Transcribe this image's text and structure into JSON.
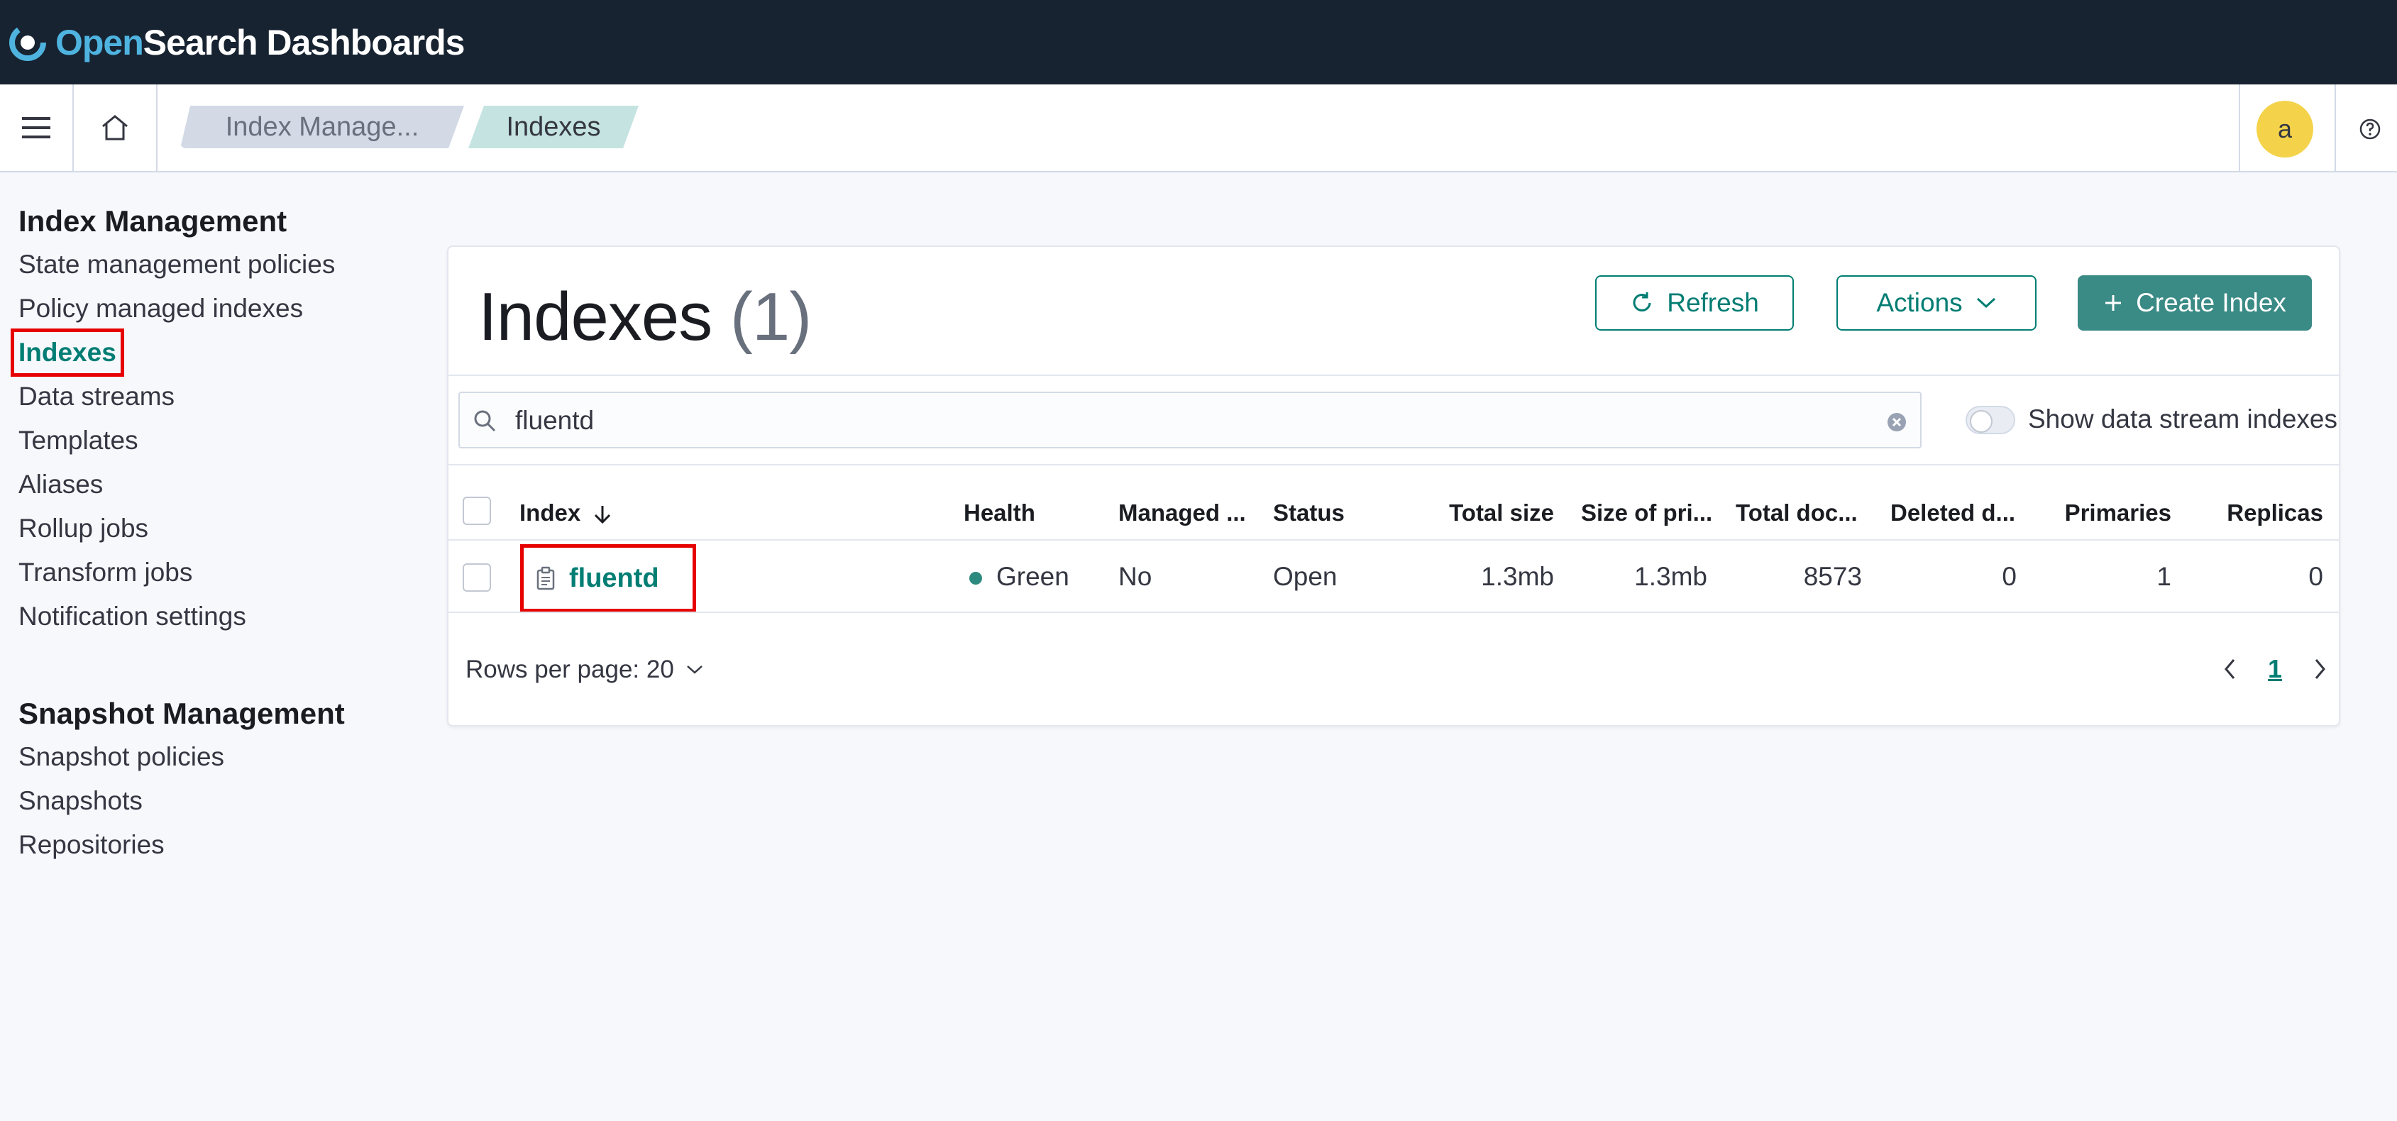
{
  "header": {
    "brand_open": "Open",
    "brand_rest": "Search Dashboards"
  },
  "breadcrumbs": [
    "Index Manage...",
    "Indexes"
  ],
  "user": {
    "avatar_initial": "a"
  },
  "sidebar": {
    "index_management": {
      "title": "Index Management",
      "items": [
        "State management policies",
        "Policy managed indexes",
        "Indexes",
        "Data streams",
        "Templates",
        "Aliases",
        "Rollup jobs",
        "Transform jobs",
        "Notification settings"
      ]
    },
    "snapshot_management": {
      "title": "Snapshot Management",
      "items": [
        "Snapshot policies",
        "Snapshots",
        "Repositories"
      ]
    }
  },
  "main": {
    "title": "Indexes",
    "count": "(1)",
    "buttons": {
      "refresh": "Refresh",
      "actions": "Actions",
      "create": "Create Index"
    },
    "search": {
      "value": "fluentd"
    },
    "toggle_label": "Show data stream indexes",
    "columns": [
      "Index",
      "Health",
      "Managed ...",
      "Status",
      "Total size",
      "Size of pri...",
      "Total doc...",
      "Deleted d...",
      "Primaries",
      "Replicas"
    ],
    "rows": [
      {
        "index": "fluentd",
        "health": "Green",
        "managed": "No",
        "status": "Open",
        "total_size": "1.3mb",
        "primary_size": "1.3mb",
        "total_docs": "8573",
        "deleted_docs": "0",
        "primaries": "1",
        "replicas": "0"
      }
    ],
    "rows_per_page": "Rows per page: 20",
    "page": "1"
  },
  "colors": {
    "header_bg": "#172331",
    "accent": "#017d73",
    "health_green": "#2d8a7e",
    "highlight": "#e60000"
  }
}
